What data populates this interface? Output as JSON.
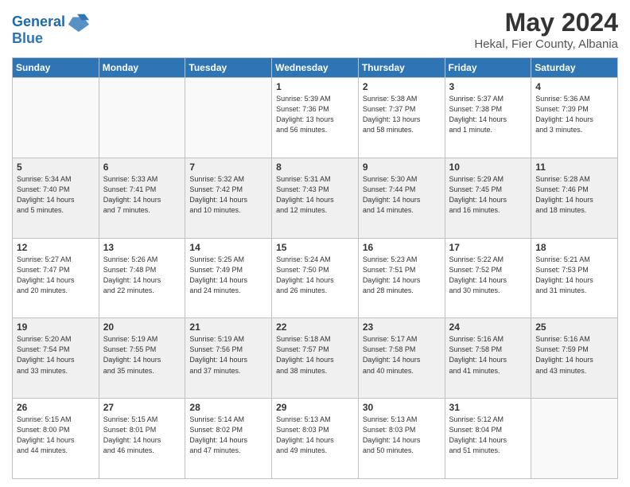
{
  "header": {
    "logo_line1": "General",
    "logo_line2": "Blue",
    "title": "May 2024",
    "subtitle": "Hekal, Fier County, Albania"
  },
  "days_of_week": [
    "Sunday",
    "Monday",
    "Tuesday",
    "Wednesday",
    "Thursday",
    "Friday",
    "Saturday"
  ],
  "weeks": [
    [
      {
        "day": "",
        "info": ""
      },
      {
        "day": "",
        "info": ""
      },
      {
        "day": "",
        "info": ""
      },
      {
        "day": "1",
        "info": "Sunrise: 5:39 AM\nSunset: 7:36 PM\nDaylight: 13 hours\nand 56 minutes."
      },
      {
        "day": "2",
        "info": "Sunrise: 5:38 AM\nSunset: 7:37 PM\nDaylight: 13 hours\nand 58 minutes."
      },
      {
        "day": "3",
        "info": "Sunrise: 5:37 AM\nSunset: 7:38 PM\nDaylight: 14 hours\nand 1 minute."
      },
      {
        "day": "4",
        "info": "Sunrise: 5:36 AM\nSunset: 7:39 PM\nDaylight: 14 hours\nand 3 minutes."
      }
    ],
    [
      {
        "day": "5",
        "info": "Sunrise: 5:34 AM\nSunset: 7:40 PM\nDaylight: 14 hours\nand 5 minutes."
      },
      {
        "day": "6",
        "info": "Sunrise: 5:33 AM\nSunset: 7:41 PM\nDaylight: 14 hours\nand 7 minutes."
      },
      {
        "day": "7",
        "info": "Sunrise: 5:32 AM\nSunset: 7:42 PM\nDaylight: 14 hours\nand 10 minutes."
      },
      {
        "day": "8",
        "info": "Sunrise: 5:31 AM\nSunset: 7:43 PM\nDaylight: 14 hours\nand 12 minutes."
      },
      {
        "day": "9",
        "info": "Sunrise: 5:30 AM\nSunset: 7:44 PM\nDaylight: 14 hours\nand 14 minutes."
      },
      {
        "day": "10",
        "info": "Sunrise: 5:29 AM\nSunset: 7:45 PM\nDaylight: 14 hours\nand 16 minutes."
      },
      {
        "day": "11",
        "info": "Sunrise: 5:28 AM\nSunset: 7:46 PM\nDaylight: 14 hours\nand 18 minutes."
      }
    ],
    [
      {
        "day": "12",
        "info": "Sunrise: 5:27 AM\nSunset: 7:47 PM\nDaylight: 14 hours\nand 20 minutes."
      },
      {
        "day": "13",
        "info": "Sunrise: 5:26 AM\nSunset: 7:48 PM\nDaylight: 14 hours\nand 22 minutes."
      },
      {
        "day": "14",
        "info": "Sunrise: 5:25 AM\nSunset: 7:49 PM\nDaylight: 14 hours\nand 24 minutes."
      },
      {
        "day": "15",
        "info": "Sunrise: 5:24 AM\nSunset: 7:50 PM\nDaylight: 14 hours\nand 26 minutes."
      },
      {
        "day": "16",
        "info": "Sunrise: 5:23 AM\nSunset: 7:51 PM\nDaylight: 14 hours\nand 28 minutes."
      },
      {
        "day": "17",
        "info": "Sunrise: 5:22 AM\nSunset: 7:52 PM\nDaylight: 14 hours\nand 30 minutes."
      },
      {
        "day": "18",
        "info": "Sunrise: 5:21 AM\nSunset: 7:53 PM\nDaylight: 14 hours\nand 31 minutes."
      }
    ],
    [
      {
        "day": "19",
        "info": "Sunrise: 5:20 AM\nSunset: 7:54 PM\nDaylight: 14 hours\nand 33 minutes."
      },
      {
        "day": "20",
        "info": "Sunrise: 5:19 AM\nSunset: 7:55 PM\nDaylight: 14 hours\nand 35 minutes."
      },
      {
        "day": "21",
        "info": "Sunrise: 5:19 AM\nSunset: 7:56 PM\nDaylight: 14 hours\nand 37 minutes."
      },
      {
        "day": "22",
        "info": "Sunrise: 5:18 AM\nSunset: 7:57 PM\nDaylight: 14 hours\nand 38 minutes."
      },
      {
        "day": "23",
        "info": "Sunrise: 5:17 AM\nSunset: 7:58 PM\nDaylight: 14 hours\nand 40 minutes."
      },
      {
        "day": "24",
        "info": "Sunrise: 5:16 AM\nSunset: 7:58 PM\nDaylight: 14 hours\nand 41 minutes."
      },
      {
        "day": "25",
        "info": "Sunrise: 5:16 AM\nSunset: 7:59 PM\nDaylight: 14 hours\nand 43 minutes."
      }
    ],
    [
      {
        "day": "26",
        "info": "Sunrise: 5:15 AM\nSunset: 8:00 PM\nDaylight: 14 hours\nand 44 minutes."
      },
      {
        "day": "27",
        "info": "Sunrise: 5:15 AM\nSunset: 8:01 PM\nDaylight: 14 hours\nand 46 minutes."
      },
      {
        "day": "28",
        "info": "Sunrise: 5:14 AM\nSunset: 8:02 PM\nDaylight: 14 hours\nand 47 minutes."
      },
      {
        "day": "29",
        "info": "Sunrise: 5:13 AM\nSunset: 8:03 PM\nDaylight: 14 hours\nand 49 minutes."
      },
      {
        "day": "30",
        "info": "Sunrise: 5:13 AM\nSunset: 8:03 PM\nDaylight: 14 hours\nand 50 minutes."
      },
      {
        "day": "31",
        "info": "Sunrise: 5:12 AM\nSunset: 8:04 PM\nDaylight: 14 hours\nand 51 minutes."
      },
      {
        "day": "",
        "info": ""
      }
    ]
  ]
}
